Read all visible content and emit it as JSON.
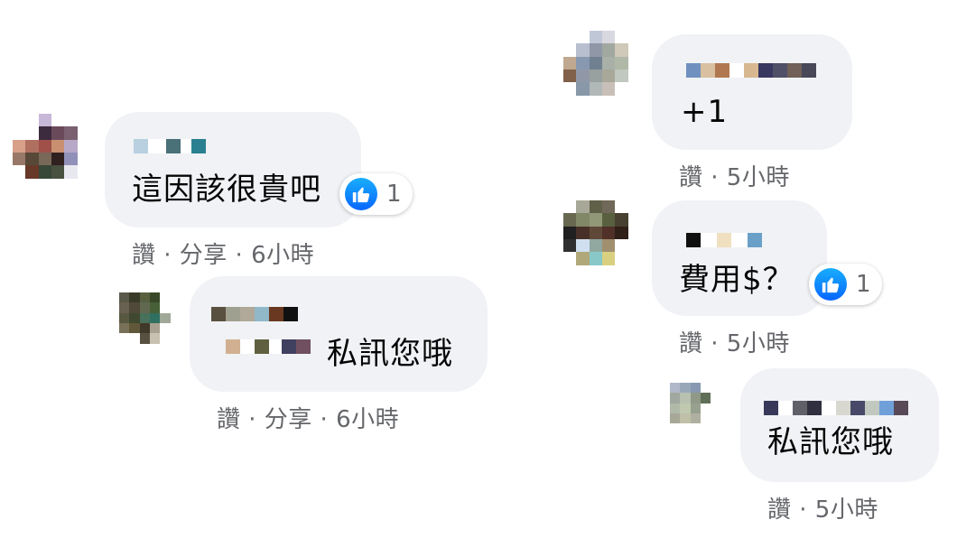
{
  "comments": [
    {
      "text": "這因該很貴吧",
      "meta": "讚 · 分享 · 6小時",
      "reaction_count": "1",
      "reaction_icon": "like-icon"
    },
    {
      "text": "私訊您哦",
      "meta": "讚 · 分享 · 6小時"
    },
    {
      "text": "+1",
      "meta": "讚 · 5小時"
    },
    {
      "text": "費用$？",
      "meta": "讚 · 5小時",
      "reaction_count": "1",
      "reaction_icon": "like-icon"
    },
    {
      "text": "私訊您哦",
      "meta": "讚 · 5小時"
    }
  ],
  "colors": {
    "bubble": "#f0f2f5",
    "meta_text": "#65676b",
    "like_blue": "#1877f2"
  }
}
